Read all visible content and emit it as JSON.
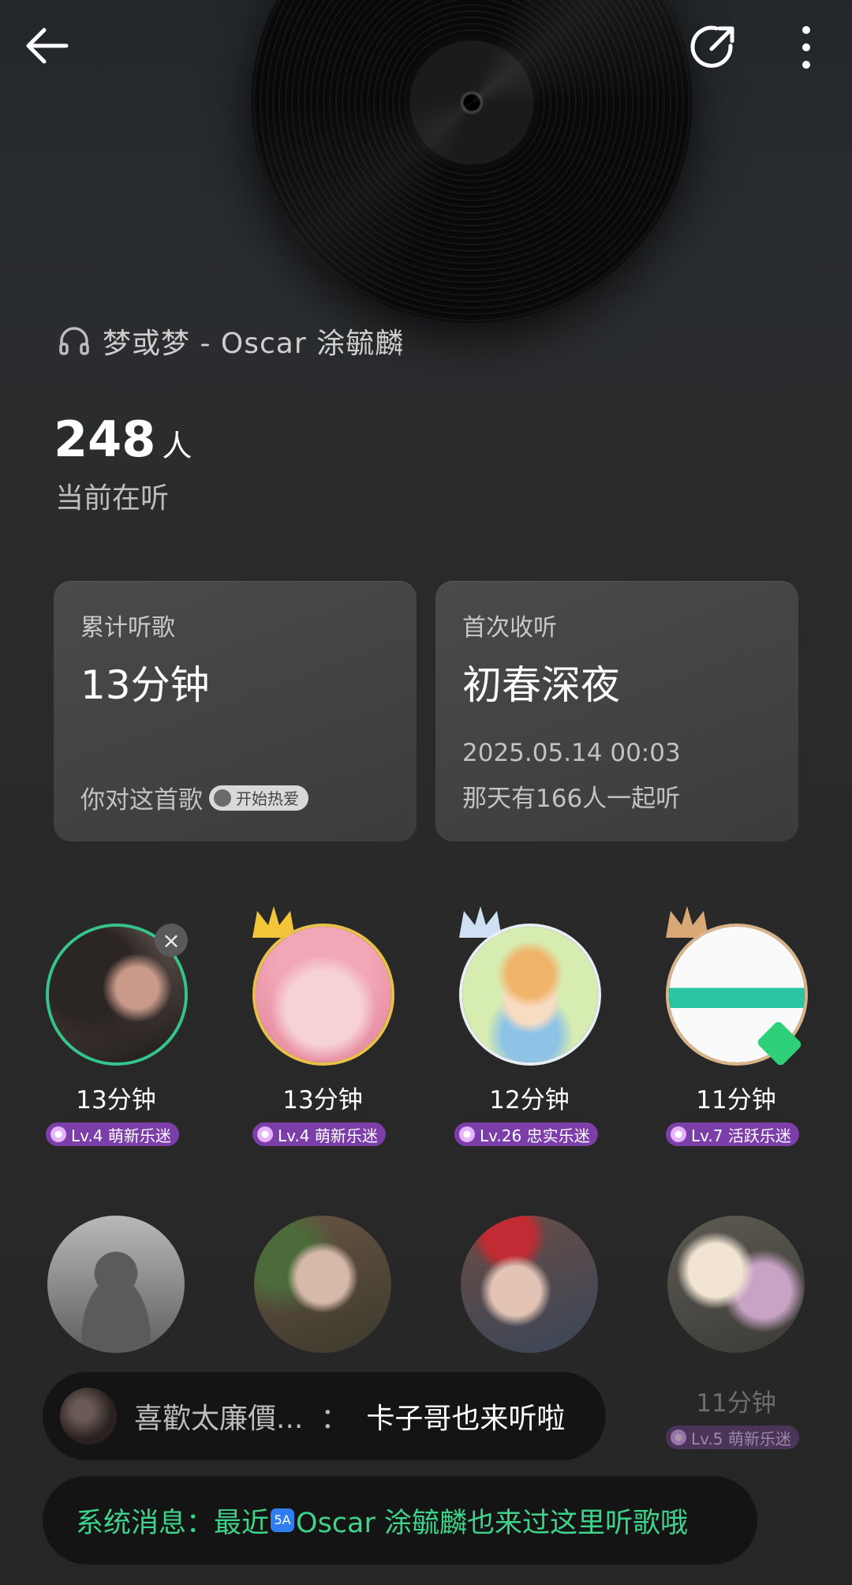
{
  "song": {
    "title": "梦或梦 - Oscar 涂毓麟"
  },
  "listening": {
    "count": "248",
    "unit": "人",
    "label": "当前在听"
  },
  "cards": {
    "total": {
      "label": "累计听歌",
      "value": "13分钟",
      "foot": "你对这首歌",
      "pill": "开始热爱"
    },
    "first": {
      "label": "首次收听",
      "value": "初春深夜",
      "date": "2025.05.14 00:03",
      "foot": "那天有166人一起听"
    }
  },
  "listeners_row1": [
    {
      "time": "13分钟",
      "level": "Lv.4 萌新乐迷"
    },
    {
      "time": "13分钟",
      "level": "Lv.4 萌新乐迷"
    },
    {
      "time": "12分钟",
      "level": "Lv.26 忠实乐迷"
    },
    {
      "time": "11分钟",
      "level": "Lv.7 活跃乐迷"
    }
  ],
  "listeners_row2": [
    {
      "time": "11分钟",
      "level": "Lv.5 萌新乐迷"
    }
  ],
  "messages": {
    "chat": {
      "name": "喜歡太廉價...",
      "sep": "：",
      "text": "卡子哥也来听啦"
    },
    "system": {
      "prefix": "系统消息：最近",
      "badge": "5A",
      "text": "Oscar 涂毓麟也来过这里听歌哦"
    }
  },
  "colors": {
    "accent_green": "#3ed38a",
    "level_purple": "#7c3ea8"
  }
}
